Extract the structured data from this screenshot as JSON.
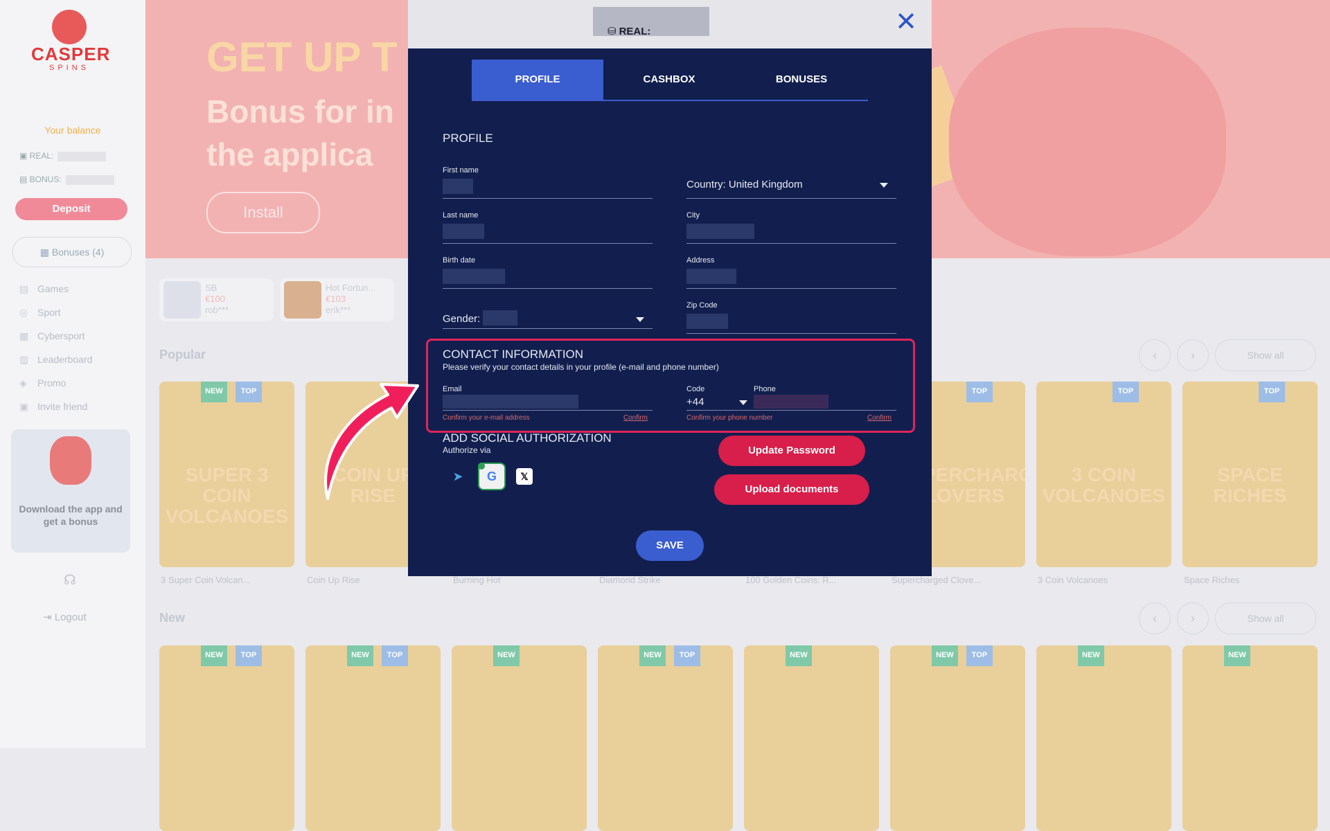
{
  "brand": {
    "name": "CASPER",
    "sub": "SPINS"
  },
  "sidebar": {
    "balance_title": "Your balance",
    "real_label": "REAL:",
    "bonus_label": "BONUS:",
    "deposit": "Deposit",
    "bonuses": "Bonuses (4)",
    "items": [
      {
        "label": "Games",
        "icon": "games-icon"
      },
      {
        "label": "Sport",
        "icon": "sport-icon"
      },
      {
        "label": "Cybersport",
        "icon": "cybersport-icon"
      },
      {
        "label": "Leaderboard",
        "icon": "leaderboard-icon"
      },
      {
        "label": "Promo",
        "icon": "promo-icon"
      },
      {
        "label": "Invite friend",
        "icon": "gift-icon"
      }
    ],
    "app_promo": "Download the app and get a bonus",
    "logout": "Logout"
  },
  "banner": {
    "headline": "GET UP T",
    "subline": "Bonus for in the applica",
    "install": "Install"
  },
  "winners": [
    {
      "name": "SB",
      "amount": "€100",
      "user": "rob***"
    },
    {
      "name": "Hot Fortun...",
      "amount": "€103",
      "user": "erik***"
    }
  ],
  "sections": {
    "popular": "Popular",
    "new": "New",
    "show_all": "Show all"
  },
  "popular_games": [
    {
      "title": "3 Super Coin Volcan...",
      "art": "SUPER 3 COIN VOLCANOES",
      "badges": [
        "NEW",
        "TOP"
      ]
    },
    {
      "title": "Coin Up Rise",
      "art": "COIN UP RISE",
      "badges": []
    },
    {
      "title": "Burning Hot",
      "art": "",
      "badges": []
    },
    {
      "title": "Diamond Strike",
      "art": "",
      "badges": []
    },
    {
      "title": "100 Golden Coins: R...",
      "art": "",
      "badges": []
    },
    {
      "title": "Supercharged Clove...",
      "art": "SUPERCHARGED CLOVERS",
      "badges": [
        "TOP"
      ]
    },
    {
      "title": "3 Coin Volcanoes",
      "art": "3 COIN VOLCANOES",
      "badges": [
        "TOP"
      ]
    },
    {
      "title": "Space Riches",
      "art": "SPACE RICHES",
      "badges": [
        "TOP"
      ]
    }
  ],
  "new_badges": [
    [
      "NEW",
      "TOP"
    ],
    [
      "NEW",
      "TOP"
    ],
    [
      "NEW"
    ],
    [
      "NEW",
      "TOP"
    ],
    [
      "NEW"
    ],
    [
      "NEW",
      "TOP"
    ],
    [
      "NEW"
    ],
    [
      "NEW"
    ]
  ],
  "modal": {
    "real_label": "REAL:",
    "tabs": [
      "PROFILE",
      "CASHBOX",
      "BONUSES"
    ],
    "profile_title": "PROFILE",
    "fields": {
      "first_name": "First name",
      "last_name": "Last name",
      "birth_date": "Birth date",
      "gender": "Gender:",
      "country": "Country: United Kingdom",
      "city": "City",
      "address": "Address",
      "zip": "Zip Code"
    },
    "contact": {
      "title": "CONTACT INFORMATION",
      "subtitle": "Please verify your contact details in your profile (e-mail and phone number)",
      "email_label": "Email",
      "code_label": "Code",
      "code_value": "+44",
      "phone_label": "Phone",
      "email_hint": "Confirm your e-mail address",
      "phone_hint": "Confirm your phone number",
      "confirm": "Confirm"
    },
    "social": {
      "title": "ADD SOCIAL AUTHORIZATION",
      "subtitle": "Authorize via",
      "providers": [
        "telegram-icon",
        "google-icon",
        "x-icon"
      ]
    },
    "update_password": "Update Password",
    "upload_documents": "Upload documents",
    "save": "SAVE"
  },
  "colors": {
    "modal_bg": "#121f4e",
    "accent_blue": "#3a5dd0",
    "accent_red": "#d81e4a",
    "highlight": "#e0245a"
  }
}
